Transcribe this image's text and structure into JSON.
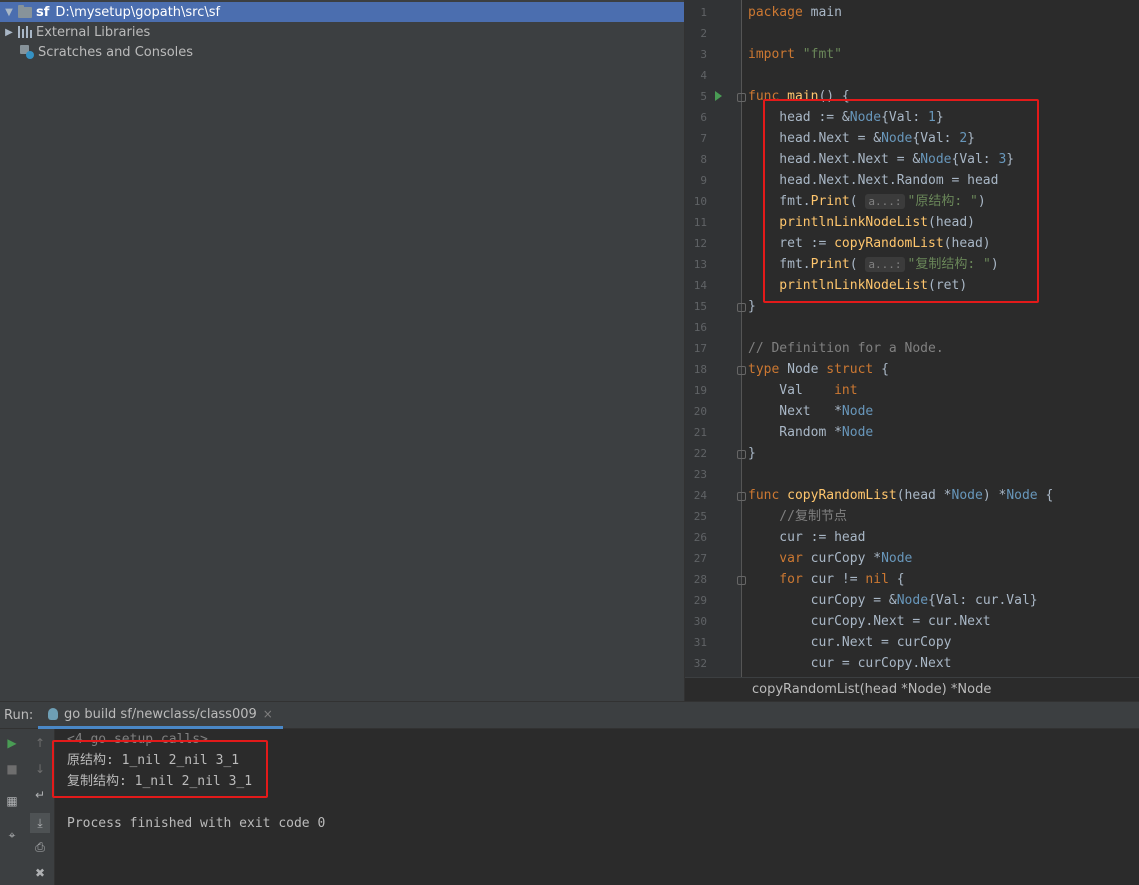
{
  "project": {
    "root_name": "sf",
    "root_path": "D:\\mysetup\\gopath\\src\\sf",
    "external_libraries": "External Libraries",
    "scratches": "Scratches and Consoles"
  },
  "editor": {
    "line_numbers": [
      "1",
      "2",
      "3",
      "4",
      "5",
      "6",
      "7",
      "8",
      "9",
      "10",
      "11",
      "12",
      "13",
      "14",
      "15",
      "16",
      "17",
      "18",
      "19",
      "20",
      "21",
      "22",
      "23",
      "24",
      "25",
      "26",
      "27",
      "28",
      "29",
      "30",
      "31",
      "32"
    ],
    "hint_label": "a...:",
    "lines": {
      "l1_kw": "package",
      "l1_rest": " main",
      "l3_kw": "import",
      "l3_str": " \"fmt\"",
      "l5_kw": "func",
      "l5_fn": " main",
      "l5_rest": "() {",
      "l6_a": "    head := &",
      "l6_ty": "Node",
      "l6_b": "{Val: ",
      "l6_num": "1",
      "l6_c": "}",
      "l7_a": "    head.Next = &",
      "l7_ty": "Node",
      "l7_b": "{Val: ",
      "l7_num": "2",
      "l7_c": "}",
      "l8_a": "    head.Next.Next = &",
      "l8_ty": "Node",
      "l8_b": "{Val: ",
      "l8_num": "3",
      "l8_c": "}",
      "l9": "    head.Next.Next.Random = head",
      "l10_a": "    fmt.",
      "l10_fn": "Print",
      "l10_b": "( ",
      "l10_str": "\"原结构: \"",
      "l10_c": ")",
      "l11_fn": "    printlnLinkNodeList",
      "l11_rest": "(head)",
      "l12_a": "    ret := ",
      "l12_fn": "copyRandomList",
      "l12_rest": "(head)",
      "l13_a": "    fmt.",
      "l13_fn": "Print",
      "l13_b": "( ",
      "l13_str": "\"复制结构: \"",
      "l13_c": ")",
      "l14_fn": "    printlnLinkNodeList",
      "l14_rest": "(ret)",
      "l15": "}",
      "l17": "// Definition for a Node.",
      "l18_kw": "type",
      "l18_a": " Node ",
      "l18_kw2": "struct",
      "l18_b": " {",
      "l19_a": "    Val    ",
      "l19_kw": "int",
      "l20_a": "    Next   *",
      "l20_ty": "Node",
      "l21_a": "    Random *",
      "l21_ty": "Node",
      "l22": "}",
      "l24_kw": "func",
      "l24_fn": " copyRandomList",
      "l24_a": "(head *",
      "l24_ty": "Node",
      "l24_b": ") *",
      "l24_ty2": "Node",
      "l24_c": " {",
      "l25": "    //复制节点",
      "l26": "    cur := head",
      "l27_kw": "    var",
      "l27_a": " curCopy *",
      "l27_ty": "Node",
      "l28_kw": "    for",
      "l28_a": " cur != ",
      "l28_kw2": "nil",
      "l28_b": " {",
      "l29_a": "        curCopy = &",
      "l29_ty": "Node",
      "l29_b": "{Val: cur.Val}",
      "l30": "        curCopy.Next = cur.Next",
      "l31": "        cur.Next = curCopy",
      "l32": "        cur = curCopy.Next"
    },
    "breadcrumb": "copyRandomList(head *Node) *Node"
  },
  "run": {
    "label": "Run:",
    "tab": "go build sf/newclass/class009",
    "close": "×",
    "console": [
      "<4 go setup calls>",
      "原结构: 1_nil 2_nil 3_1",
      "复制结构: 1_nil 2_nil 3_1",
      "Process finished with exit code 0"
    ]
  }
}
